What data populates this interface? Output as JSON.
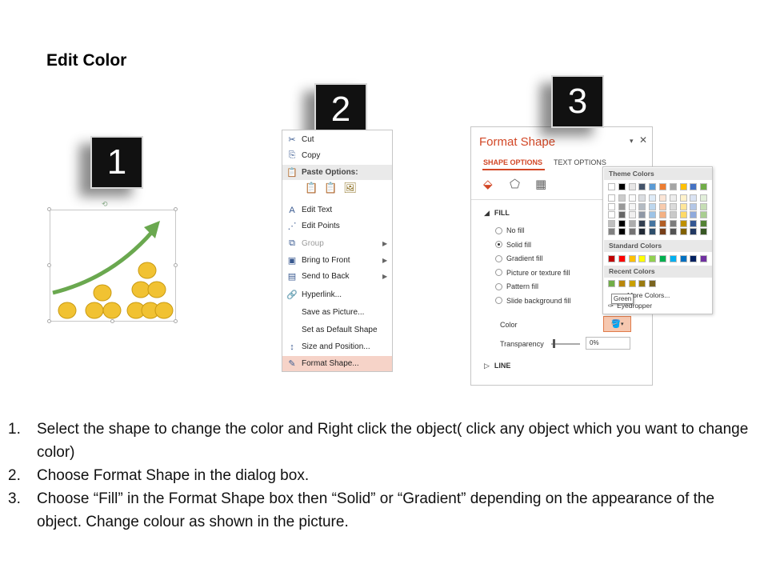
{
  "page": {
    "title": "Edit Color"
  },
  "badges": [
    "1",
    "2",
    "3"
  ],
  "context_menu": {
    "items": [
      {
        "icon": "cut-icon",
        "glyph": "✂",
        "label": "Cut",
        "submenu": false,
        "disabled": false
      },
      {
        "icon": "copy-icon",
        "glyph": "⎘",
        "label": "Copy",
        "submenu": false,
        "disabled": false
      },
      {
        "icon": "paste-icon",
        "glyph": "📋",
        "label": "Paste Options:",
        "submenu": false,
        "disabled": false,
        "header": true
      },
      {
        "icon": "edit-text-icon",
        "glyph": "A",
        "label": "Edit Text",
        "submenu": false,
        "disabled": false
      },
      {
        "icon": "edit-points-icon",
        "glyph": "⋰",
        "label": "Edit Points",
        "submenu": false,
        "disabled": false
      },
      {
        "icon": "group-icon",
        "glyph": "⧉",
        "label": "Group",
        "submenu": true,
        "disabled": true
      },
      {
        "icon": "bring-to-front-icon",
        "glyph": "▣",
        "label": "Bring to Front",
        "submenu": true,
        "disabled": false
      },
      {
        "icon": "send-to-back-icon",
        "glyph": "▤",
        "label": "Send to Back",
        "submenu": true,
        "disabled": false
      },
      {
        "icon": "hyperlink-icon",
        "glyph": "🔗",
        "label": "Hyperlink...",
        "submenu": false,
        "disabled": false
      },
      {
        "icon": "",
        "glyph": "",
        "label": "Save as Picture...",
        "submenu": false,
        "disabled": false
      },
      {
        "icon": "",
        "glyph": "",
        "label": "Set as Default Shape",
        "submenu": false,
        "disabled": false
      },
      {
        "icon": "size-position-icon",
        "glyph": "↕",
        "label": "Size and Position...",
        "submenu": false,
        "disabled": false
      },
      {
        "icon": "format-shape-icon",
        "glyph": "✎",
        "label": "Format Shape...",
        "submenu": false,
        "disabled": false,
        "highlight": true
      }
    ]
  },
  "format_pane": {
    "title": "Format Shape",
    "tabs": [
      "SHAPE OPTIONS",
      "TEXT OPTIONS"
    ],
    "fill_section": "FILL",
    "fill_options": [
      {
        "label": "No fill",
        "selected": false
      },
      {
        "label": "Solid fill",
        "selected": true
      },
      {
        "label": "Gradient fill",
        "selected": false
      },
      {
        "label": "Picture or texture fill",
        "selected": false
      },
      {
        "label": "Pattern fill",
        "selected": false
      },
      {
        "label": "Slide background fill",
        "selected": false
      }
    ],
    "color_label": "Color",
    "transparency_label": "Transparency",
    "transparency_value": "0%",
    "line_section": "LINE"
  },
  "color_dropdown": {
    "theme_header": "Theme Colors",
    "standard_header": "Standard Colors",
    "recent_header": "Recent Colors",
    "more_colors": "More Colors...",
    "eyedropper": "Eyedropper",
    "tooltip": "Green",
    "theme_colors": [
      "#ffffff",
      "#000000",
      "#e7e6e6",
      "#44546a",
      "#5b9bd5",
      "#ed7d31",
      "#a5a5a5",
      "#ffc000",
      "#4472c4",
      "#70ad47"
    ],
    "standard_colors": [
      "#c00000",
      "#ff0000",
      "#ffc000",
      "#ffff00",
      "#92d050",
      "#00b050",
      "#00b0f0",
      "#0070c0",
      "#002060",
      "#7030a0"
    ],
    "recent_colors": [
      "#70ad47",
      "#b8860b",
      "#c9a000",
      "#9a7b10",
      "#7a6420"
    ]
  },
  "instructions": [
    {
      "num": "1.",
      "text": "Select the shape to change the color and Right click the object( click any object which you want to change color)"
    },
    {
      "num": "2.",
      "text": "Choose Format Shape in the dialog box."
    },
    {
      "num": "3.",
      "text": "Choose “Fill” in the Format Shape box then “Solid” or “Gradient” depending on the appearance of the object. Change colour as shown in the picture."
    }
  ]
}
